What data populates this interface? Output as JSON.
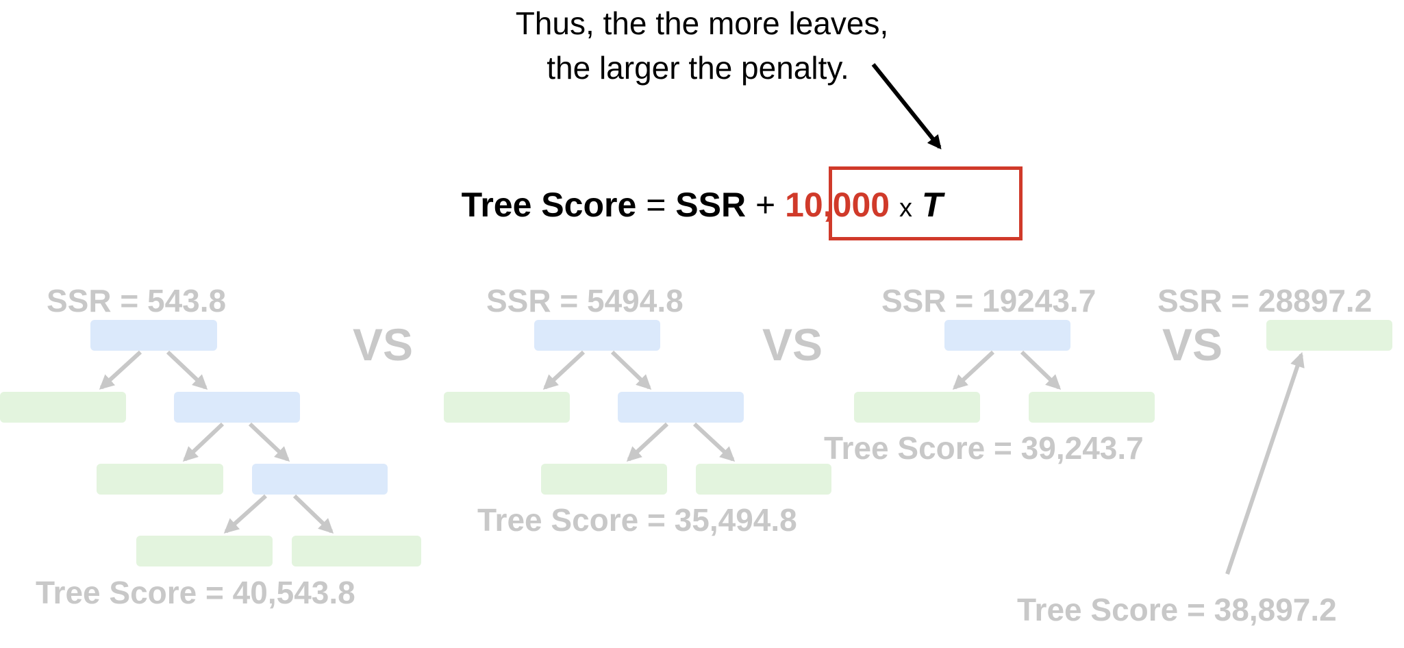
{
  "caption": {
    "line1": "Thus, the the more leaves,",
    "line2": "the larger the penalty."
  },
  "formula": {
    "term1": "Tree Score",
    "equals": "=",
    "term2": "SSR",
    "plus": "+",
    "coefficient": "10,000",
    "times": "x",
    "variable": "T"
  },
  "colors": {
    "highlight": "#d03a2a",
    "faded_text": "#c8c8c8",
    "internal_node": "#dbe9fb",
    "leaf_node": "#e3f4de"
  },
  "trees": [
    {
      "ssr": "SSR = 543.8",
      "score": "Tree Score = 40,543.8",
      "leaves": 4
    },
    {
      "ssr": "SSR = 5494.8",
      "score": "Tree Score = 35,494.8",
      "leaves": 3
    },
    {
      "ssr": "SSR = 19243.7",
      "score": "Tree Score = 39,243.7",
      "leaves": 2
    },
    {
      "ssr": "SSR = 28897.2",
      "score": "Tree Score = 38,897.2",
      "leaves": 1
    }
  ],
  "separator": "VS"
}
